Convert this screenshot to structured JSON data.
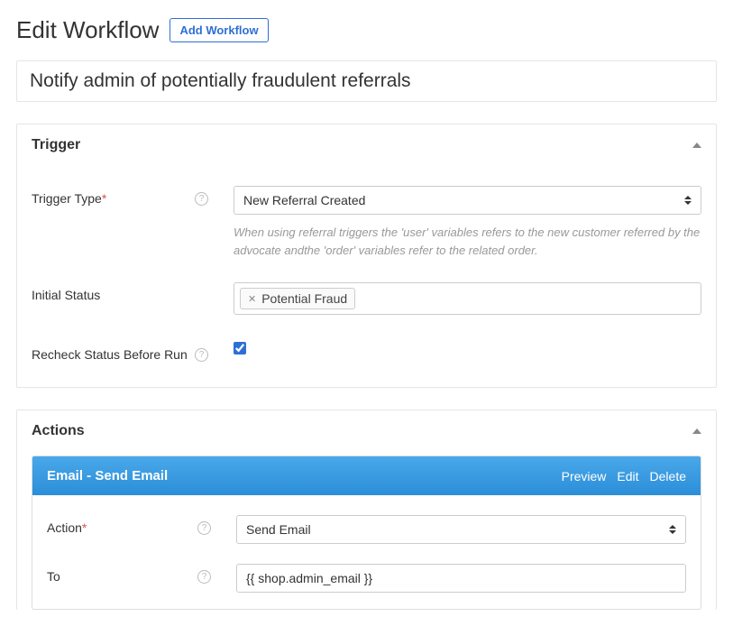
{
  "header": {
    "title": "Edit Workflow",
    "add_button": "Add Workflow"
  },
  "workflow_name": "Notify admin of potentially fraudulent referrals",
  "trigger": {
    "title": "Trigger",
    "type_label": "Trigger Type",
    "type_value": "New Referral Created",
    "type_hint": "When using referral triggers the 'user' variables refers to the new customer referred by the advocate andthe 'order' variables refer to the related order.",
    "initial_status_label": "Initial Status",
    "initial_status_tag": "Potential Fraud",
    "recheck_label": "Recheck Status Before Run",
    "recheck_checked": true
  },
  "actions": {
    "title": "Actions",
    "email": {
      "header_title": "Email - Send Email",
      "preview": "Preview",
      "edit": "Edit",
      "delete": "Delete",
      "action_label": "Action",
      "action_value": "Send Email",
      "to_label": "To",
      "to_value": "{{ shop.admin_email }}"
    }
  }
}
